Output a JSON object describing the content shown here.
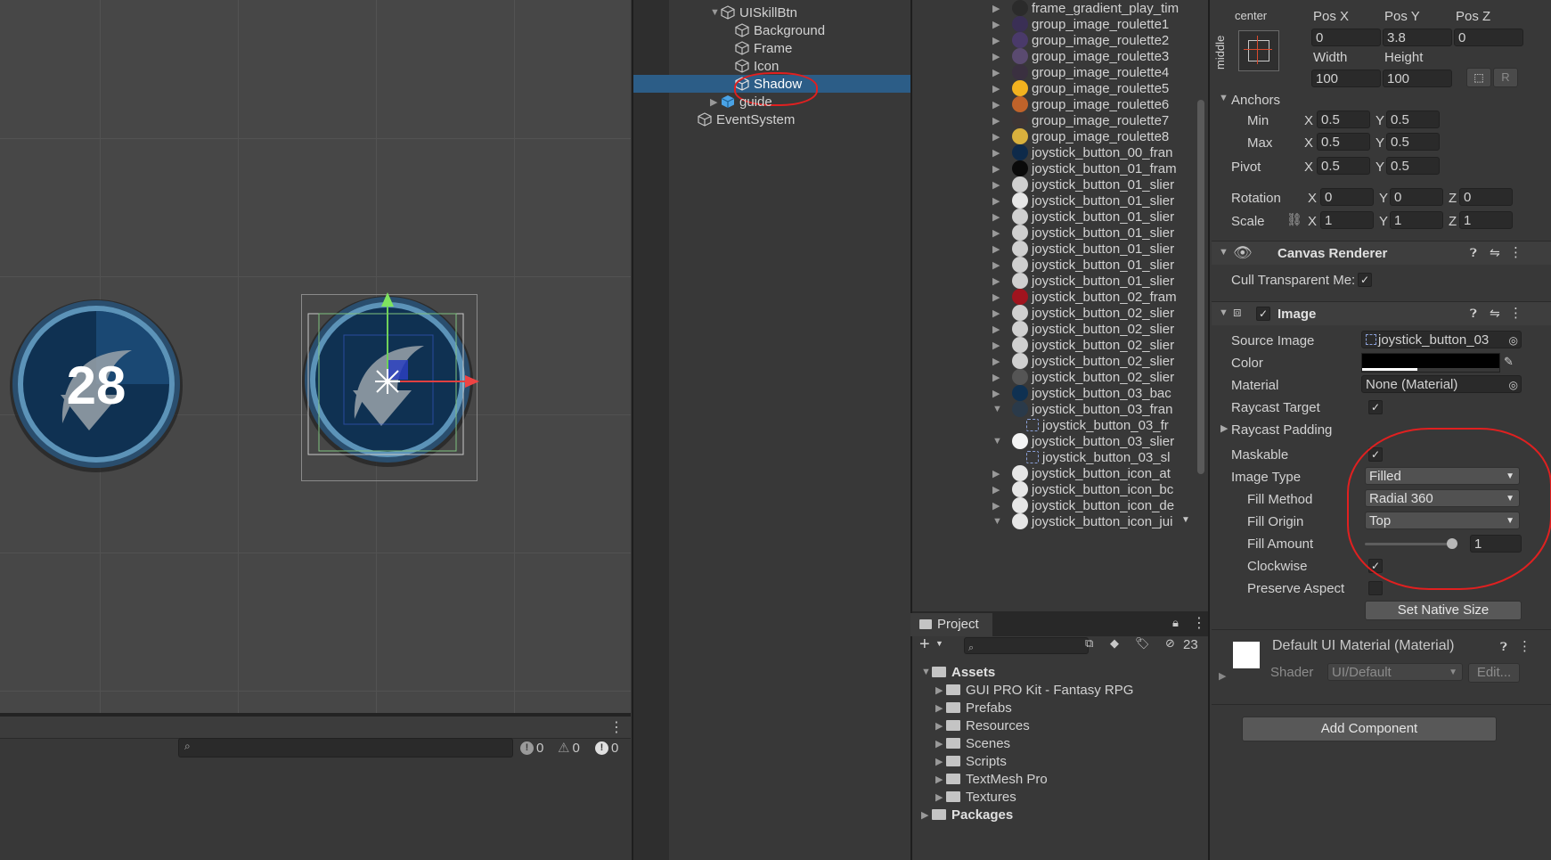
{
  "scene": {
    "left_icon_number": "28"
  },
  "console": {
    "menu_icon": "kebab-icon",
    "search_placeholder": "",
    "counts": {
      "info": "0",
      "warning": "0",
      "error": "0"
    }
  },
  "hierarchy": {
    "items": [
      {
        "label": "UISkillBtn",
        "expanded": true
      },
      {
        "label": "Background"
      },
      {
        "label": "Frame"
      },
      {
        "label": "Icon"
      },
      {
        "label": "Shadow",
        "selected": true
      },
      {
        "label": "guide"
      },
      {
        "label": "EventSystem"
      }
    ]
  },
  "sprites": {
    "items": [
      "frame_gradient_play_tim",
      "group_image_roulette1",
      "group_image_roulette2",
      "group_image_roulette3",
      "group_image_roulette4",
      "group_image_roulette5",
      "group_image_roulette6",
      "group_image_roulette7",
      "group_image_roulette8",
      "joystick_button_00_fran",
      "joystick_button_01_fram",
      "joystick_button_01_slier",
      "joystick_button_01_slier",
      "joystick_button_01_slier",
      "joystick_button_01_slier",
      "joystick_button_01_slier",
      "joystick_button_01_slier",
      "joystick_button_01_slier",
      "joystick_button_02_fram",
      "joystick_button_02_slier",
      "joystick_button_02_slier",
      "joystick_button_02_slier",
      "joystick_button_02_slier",
      "joystick_button_02_slier",
      "joystick_button_03_bac",
      "joystick_button_03_fran",
      "joystick_button_03_fr",
      "joystick_button_03_slier",
      "joystick_button_03_sl",
      "joystick_button_icon_at",
      "joystick_button_icon_bc",
      "joystick_button_icon_de",
      "joystick_button_icon_jui"
    ]
  },
  "project": {
    "tab_label": "Project",
    "hidden_count": "23",
    "tree": [
      {
        "label": "Assets",
        "bold": true
      },
      {
        "label": "GUI PRO Kit - Fantasy RPG"
      },
      {
        "label": "Prefabs"
      },
      {
        "label": "Resources"
      },
      {
        "label": "Scenes"
      },
      {
        "label": "Scripts"
      },
      {
        "label": "TextMesh Pro"
      },
      {
        "label": "Textures"
      },
      {
        "label": "Packages",
        "bold": true
      }
    ]
  },
  "inspector": {
    "rect": {
      "anchor_h": "center",
      "anchor_v": "middle",
      "pos_x_label": "Pos X",
      "pos_y_label": "Pos Y",
      "pos_z_label": "Pos Z",
      "pos_x": "0",
      "pos_y": "3.8",
      "pos_z": "0",
      "width_label": "Width",
      "height_label": "Height",
      "width": "100",
      "height": "100",
      "r_button": "R",
      "anchors_label": "Anchors",
      "min_label": "Min",
      "max_label": "Max",
      "pivot_label": "Pivot",
      "min_x": "0.5",
      "min_y": "0.5",
      "max_x": "0.5",
      "max_y": "0.5",
      "pivot_x": "0.5",
      "pivot_y": "0.5",
      "rotation_label": "Rotation",
      "scale_label": "Scale",
      "rot_x": "0",
      "rot_y": "0",
      "rot_z": "0",
      "scale_x": "1",
      "scale_y": "1",
      "scale_z": "1",
      "x": "X",
      "y": "Y",
      "z": "Z"
    },
    "canvas_renderer": {
      "title": "Canvas Renderer",
      "cull_label": "Cull Transparent Me:",
      "cull_checked": true
    },
    "image": {
      "title": "Image",
      "source_image_label": "Source Image",
      "source_image_value": "joystick_button_03",
      "color_label": "Color",
      "color_value": "#000000",
      "material_label": "Material",
      "material_value": "None (Material)",
      "raycast_target_label": "Raycast Target",
      "raycast_padding_label": "Raycast Padding",
      "maskable_label": "Maskable",
      "image_type_label": "Image Type",
      "image_type_value": "Filled",
      "fill_method_label": "Fill Method",
      "fill_method_value": "Radial 360",
      "fill_origin_label": "Fill Origin",
      "fill_origin_value": "Top",
      "fill_amount_label": "Fill Amount",
      "fill_amount_value": "1",
      "clockwise_label": "Clockwise",
      "preserve_aspect_label": "Preserve Aspect",
      "set_native_size": "Set Native Size"
    },
    "material_preview": {
      "title": "Default UI Material (Material)",
      "shader_label": "Shader",
      "shader_value": "UI/Default",
      "edit_button": "Edit..."
    },
    "add_component": "Add Component"
  }
}
